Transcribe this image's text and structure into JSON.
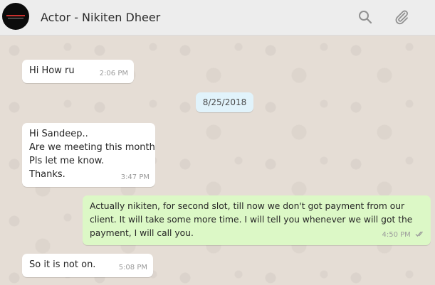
{
  "header": {
    "contact_name": "Actor - Nikiten Dheer",
    "search_icon": "search-icon",
    "attach_icon": "paperclip-icon"
  },
  "colors": {
    "header_bg": "#ededed",
    "chat_bg": "#e5ddd5",
    "incoming_bubble": "#ffffff",
    "outgoing_bubble": "#dcf8c6",
    "date_pill": "#e1f3fb"
  },
  "messages": [
    {
      "direction": "in",
      "lines": [
        "Hi How ru"
      ],
      "time": "2:06 PM"
    },
    {
      "direction": "date",
      "text": "8/25/2018"
    },
    {
      "direction": "in",
      "lines": [
        "Hi Sandeep..",
        "Are we meeting this month",
        "Pls let me know.",
        "Thanks."
      ],
      "time": "3:47 PM"
    },
    {
      "direction": "out",
      "lines": [
        "Actually nikiten, for second slot, till now we don't got payment from our",
        "client. It will take some more time. I will tell you whenever we will got the",
        "payment, I will call you."
      ],
      "time": "4:50 PM",
      "status_icon": "double-check-icon"
    },
    {
      "direction": "in",
      "lines": [
        "So it is not on."
      ],
      "time": "5:08 PM"
    }
  ]
}
